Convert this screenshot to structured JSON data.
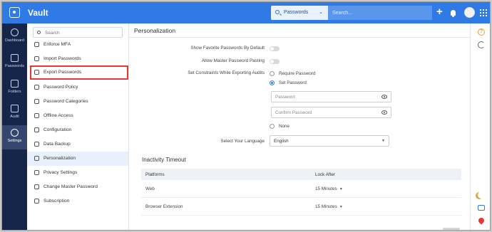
{
  "app": {
    "title": "Vault"
  },
  "topbar": {
    "search_type": "Passwords",
    "search_placeholder": "Search...",
    "add_icon": "plus-icon",
    "notifications_icon": "bell-icon",
    "apps_icon": "grid-icon"
  },
  "rail": {
    "items": [
      {
        "label": "Dashboard",
        "icon": "dashboard-icon"
      },
      {
        "label": "Passwords",
        "icon": "key-icon"
      },
      {
        "label": "Folders",
        "icon": "folder-icon"
      },
      {
        "label": "Audit",
        "icon": "audit-icon"
      },
      {
        "label": "Settings",
        "icon": "gear-icon",
        "active": true
      }
    ]
  },
  "subnav": {
    "search_placeholder": "Search",
    "items": [
      {
        "label": "Enforce MFA"
      },
      {
        "label": "Import Passwords"
      },
      {
        "label": "Export Passwords",
        "highlighted": true
      },
      {
        "label": "Password Policy"
      },
      {
        "label": "Password Categories"
      },
      {
        "label": "Offline Access"
      },
      {
        "label": "Configuration"
      },
      {
        "label": "Data Backup"
      },
      {
        "label": "Personalization",
        "selected": true
      },
      {
        "label": "Privacy Settings"
      },
      {
        "label": "Change Master Password"
      },
      {
        "label": "Subscription"
      }
    ]
  },
  "main": {
    "title": "Personalization",
    "show_favorites_label": "Show Favorite Passwords By Default",
    "allow_master_paste_label": "Allow Master Password Pasting",
    "constraints_label": "Set Constraints While Exporting Audits",
    "constraint_options": {
      "require": "Require Password",
      "set": "Set Password",
      "none": "None"
    },
    "password_placeholder": "Password",
    "confirm_password_placeholder": "Confirm Password",
    "language_label": "Select Your Language",
    "language_value": "English",
    "inactivity": {
      "title": "Inactivity Timeout",
      "headers": {
        "platforms": "Platforms",
        "lock_after": "Lock After"
      },
      "rows": [
        {
          "platform": "Web",
          "lock": "15 Minutes"
        },
        {
          "platform": "Browser Extension",
          "lock": "15 Minutes"
        }
      ]
    }
  },
  "colors": {
    "brand": "#2f7ae5",
    "rail": "#15264a",
    "highlight": "#e53935"
  }
}
